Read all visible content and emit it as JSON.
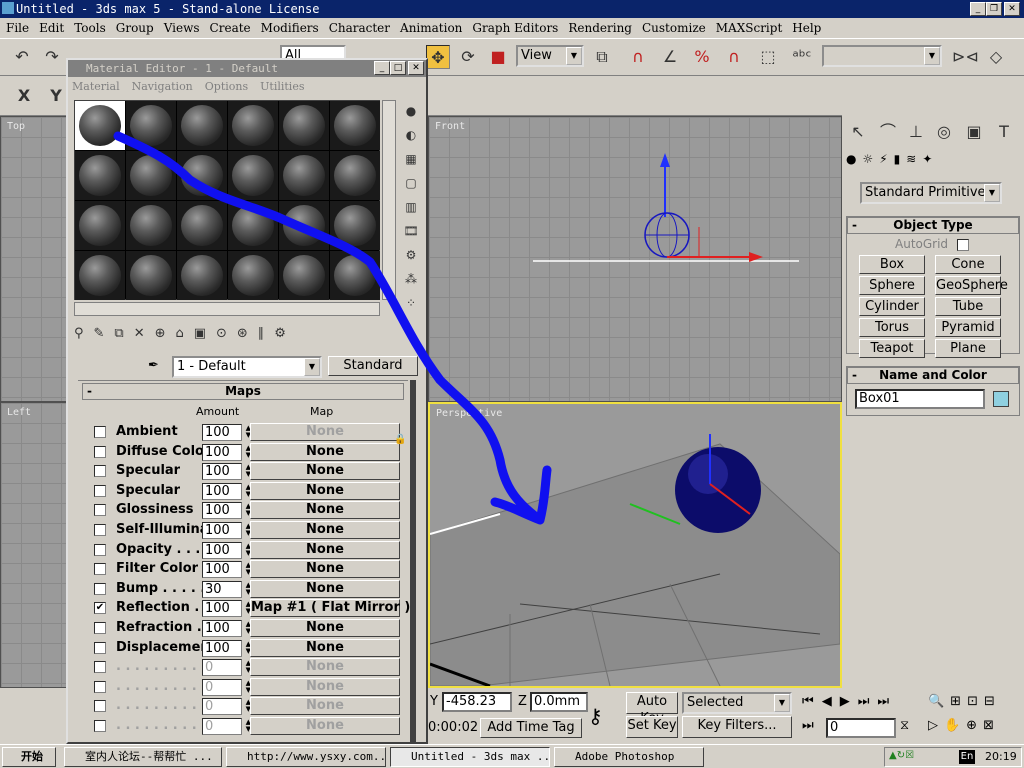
{
  "window": {
    "title": "Untitled - 3ds max 5 - Stand-alone License"
  },
  "menu": [
    "File",
    "Edit",
    "Tools",
    "Group",
    "Views",
    "Create",
    "Modifiers",
    "Character",
    "Animation",
    "Graph Editors",
    "Rendering",
    "Customize",
    "MAXScript",
    "Help"
  ],
  "toolbar": {
    "selection_filter": "All",
    "ref_coord": "View",
    "named_selection": ""
  },
  "viewports": {
    "top": "Top",
    "front": "Front",
    "left": "Left",
    "perspective": "Perspective"
  },
  "command_panel": {
    "category": "Standard Primitive",
    "object_type_header": "Object Type",
    "autogrid": "AutoGrid",
    "buttons": [
      "Box",
      "Cone",
      "Sphere",
      "GeoSphere",
      "Cylinder",
      "Tube",
      "Torus",
      "Pyramid",
      "Teapot",
      "Plane"
    ],
    "name_color_header": "Name and Color",
    "object_name": "Box01",
    "color": "#8fd0e0"
  },
  "material_editor": {
    "title": "Material Editor - 1 - Default",
    "menu": [
      "Material",
      "Navigation",
      "Options",
      "Utilities"
    ],
    "material_name": "1 - Default",
    "material_type": "Standard",
    "maps_header": "Maps",
    "col_amount": "Amount",
    "col_map": "Map",
    "maps": [
      {
        "label": "Ambient",
        "amount": "100",
        "map": "None",
        "checked": false
      },
      {
        "label": "Diffuse Color",
        "amount": "100",
        "map": "None",
        "checked": false
      },
      {
        "label": "Specular",
        "amount": "100",
        "map": "None",
        "checked": false
      },
      {
        "label": "Specular",
        "amount": "100",
        "map": "None",
        "checked": false
      },
      {
        "label": "Glossiness",
        "amount": "100",
        "map": "None",
        "checked": false
      },
      {
        "label": "Self-Illuminat",
        "amount": "100",
        "map": "None",
        "checked": false
      },
      {
        "label": "Opacity . . . .",
        "amount": "100",
        "map": "None",
        "checked": false
      },
      {
        "label": "Filter Color .",
        "amount": "100",
        "map": "None",
        "checked": false
      },
      {
        "label": "Bump . . . . .",
        "amount": "30",
        "map": "None",
        "checked": false
      },
      {
        "label": "Reflection .",
        "amount": "100",
        "map": "Map #1  ( Flat Mirror )",
        "checked": true
      },
      {
        "label": "Refraction .",
        "amount": "100",
        "map": "None",
        "checked": false
      },
      {
        "label": "Displacemen",
        "amount": "100",
        "map": "None",
        "checked": false
      },
      {
        "label": ". . . . . . . . . .",
        "amount": "0",
        "map": "None",
        "checked": false
      },
      {
        "label": ". . . . . . . . . .",
        "amount": "0",
        "map": "None",
        "checked": false
      },
      {
        "label": ". . . . . . . . . .",
        "amount": "0",
        "map": "None",
        "checked": false
      },
      {
        "label": ". . . . . . . . . .",
        "amount": "0",
        "map": "None",
        "checked": false
      }
    ]
  },
  "status": {
    "y_label": "Y",
    "y_value": "-458.23",
    "z_label": "Z",
    "z_value": "0.0mm",
    "auto_key": "Auto Key",
    "set_key": "Set Key",
    "key_mode": "Selected",
    "key_filters": "Key Filters...",
    "time": "0:00:02",
    "add_time_tag": "Add Time Tag",
    "frame": "0"
  },
  "taskbar": {
    "start": "开始",
    "tasks": [
      "室内人论坛--帮帮忙 ...",
      "http://www.ysxy.com...",
      "Untitled - 3ds max ...",
      "Adobe Photoshop"
    ],
    "clock": "20:19",
    "ime": "En"
  }
}
